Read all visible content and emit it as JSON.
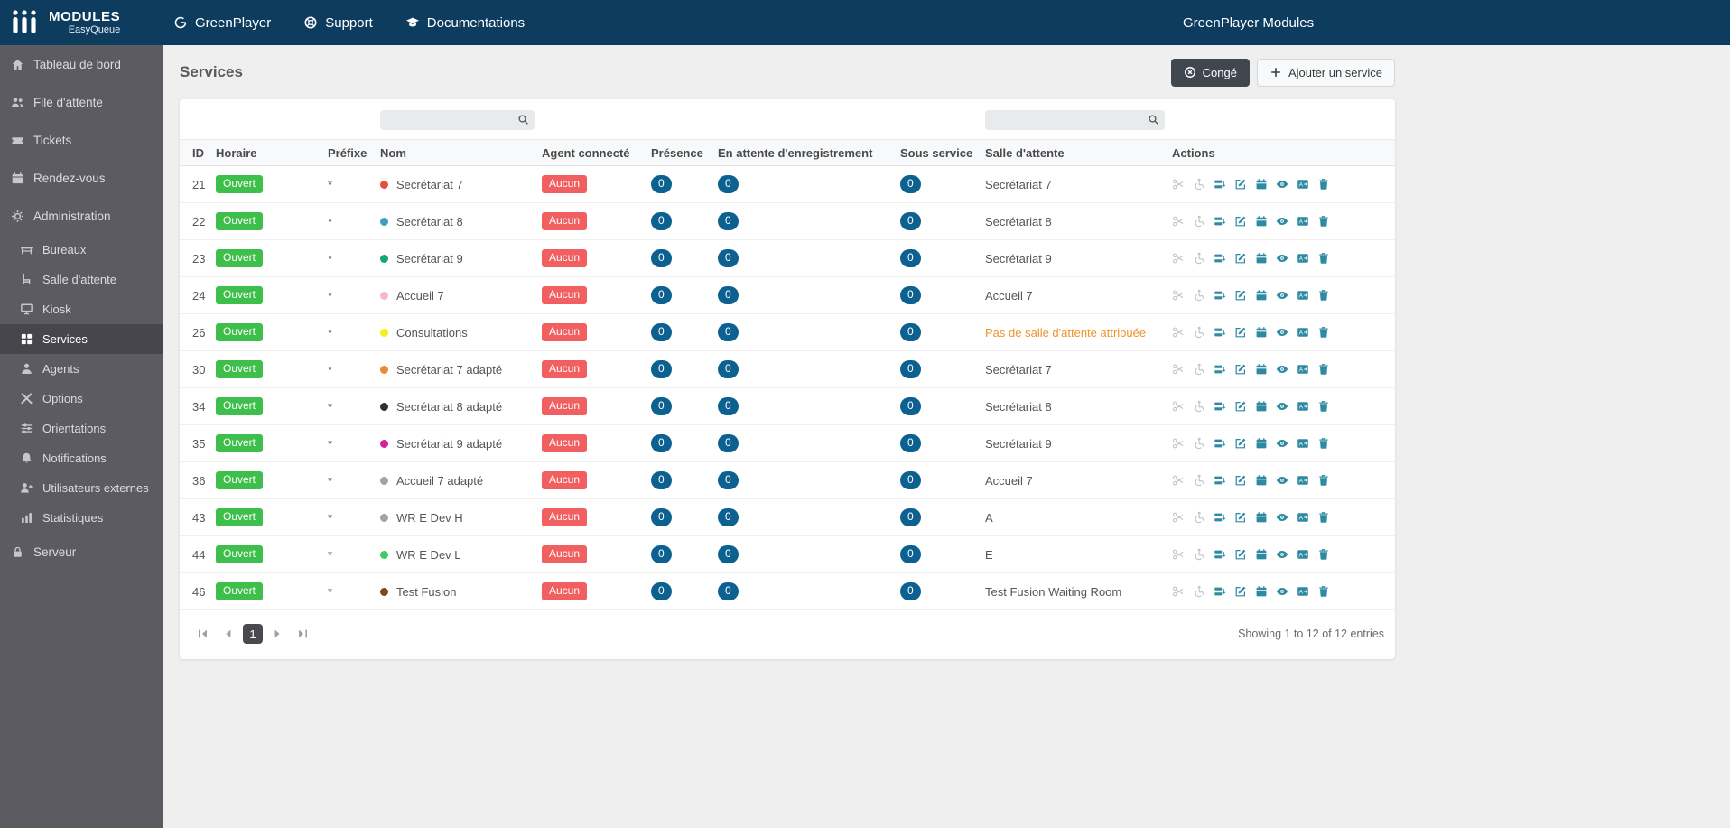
{
  "topbar": {
    "brand": {
      "title": "MODULES",
      "subtitle": "EasyQueue",
      "logo_icon": "bars-logo-icon"
    },
    "nav": [
      {
        "label": "GreenPlayer",
        "icon": "greenplayer-icon"
      },
      {
        "label": "Support",
        "icon": "support-icon"
      },
      {
        "label": "Documentations",
        "icon": "documentations-icon"
      }
    ],
    "right_title": "GreenPlayer Modules"
  },
  "sidebar": {
    "items": [
      {
        "label": "Tableau de bord",
        "icon": "dashboard-icon",
        "sub": false
      },
      {
        "label": "File d'attente",
        "icon": "queue-icon",
        "sub": false
      },
      {
        "label": "Tickets",
        "icon": "tickets-icon",
        "sub": false
      },
      {
        "label": "Rendez-vous",
        "icon": "appointments-icon",
        "sub": false
      },
      {
        "label": "Administration",
        "icon": "gear-icon",
        "sub": false
      },
      {
        "label": "Bureaux",
        "icon": "desk-icon",
        "sub": true
      },
      {
        "label": "Salle d'attente",
        "icon": "waiting-room-icon",
        "sub": true
      },
      {
        "label": "Kiosk",
        "icon": "kiosk-icon",
        "sub": true
      },
      {
        "label": "Services",
        "icon": "services-icon",
        "sub": true,
        "active": true
      },
      {
        "label": "Agents",
        "icon": "agent-icon",
        "sub": true
      },
      {
        "label": "Options",
        "icon": "options-icon",
        "sub": true
      },
      {
        "label": "Orientations",
        "icon": "orientations-icon",
        "sub": true
      },
      {
        "label": "Notifications",
        "icon": "notifications-icon",
        "sub": true
      },
      {
        "label": "Utilisateurs externes",
        "icon": "external-users-icon",
        "sub": true
      },
      {
        "label": "Statistiques",
        "icon": "statistics-icon",
        "sub": true
      },
      {
        "label": "Serveur",
        "icon": "server-icon",
        "sub": false
      }
    ]
  },
  "page": {
    "title": "Services",
    "leave_button": {
      "label": "Congé",
      "icon": "leave-icon"
    },
    "add_button": {
      "label": "Ajouter un service",
      "icon": "plus-icon"
    }
  },
  "table": {
    "search_name_value": "",
    "search_name_placeholder": "",
    "search_room_value": "",
    "search_room_placeholder": "",
    "columns": [
      "ID",
      "Horaire",
      "Préfixe",
      "Nom",
      "Agent connecté",
      "Présence",
      "En attente d'enregistrement",
      "Sous service",
      "Salle d'attente",
      "Actions"
    ],
    "rows": [
      {
        "id": "21",
        "schedule": "Ouvert",
        "prefix": "*",
        "name": "Secrétariat 7",
        "color": "#e74c3c",
        "agent": "Aucun",
        "presence": "0",
        "registering": "0",
        "sub_service": "0",
        "waiting_room": "Secrétariat 7"
      },
      {
        "id": "22",
        "schedule": "Ouvert",
        "prefix": "*",
        "name": "Secrétariat 8",
        "color": "#3e9fc0",
        "agent": "Aucun",
        "presence": "0",
        "registering": "0",
        "sub_service": "0",
        "waiting_room": "Secrétariat 8"
      },
      {
        "id": "23",
        "schedule": "Ouvert",
        "prefix": "*",
        "name": "Secrétariat 9",
        "color": "#18a476",
        "agent": "Aucun",
        "presence": "0",
        "registering": "0",
        "sub_service": "0",
        "waiting_room": "Secrétariat 9"
      },
      {
        "id": "24",
        "schedule": "Ouvert",
        "prefix": "*",
        "name": "Accueil 7",
        "color": "#f6b9c3",
        "agent": "Aucun",
        "presence": "0",
        "registering": "0",
        "sub_service": "0",
        "waiting_room": "Accueil 7"
      },
      {
        "id": "26",
        "schedule": "Ouvert",
        "prefix": "*",
        "name": "Consultations",
        "color": "#f6ef1c",
        "agent": "Aucun",
        "presence": "0",
        "registering": "0",
        "sub_service": "0",
        "waiting_room": "Pas de salle d'attente attribuée",
        "no_room": true
      },
      {
        "id": "30",
        "schedule": "Ouvert",
        "prefix": "*",
        "name": "Secrétariat 7 adapté",
        "color": "#ec8b33",
        "agent": "Aucun",
        "presence": "0",
        "registering": "0",
        "sub_service": "0",
        "waiting_room": "Secrétariat 7"
      },
      {
        "id": "34",
        "schedule": "Ouvert",
        "prefix": "*",
        "name": "Secrétariat 8 adapté",
        "color": "#2f2f2f",
        "agent": "Aucun",
        "presence": "0",
        "registering": "0",
        "sub_service": "0",
        "waiting_room": "Secrétariat 8"
      },
      {
        "id": "35",
        "schedule": "Ouvert",
        "prefix": "*",
        "name": "Secrétariat 9 adapté",
        "color": "#d6219c",
        "agent": "Aucun",
        "presence": "0",
        "registering": "0",
        "sub_service": "0",
        "waiting_room": "Secrétariat 9"
      },
      {
        "id": "36",
        "schedule": "Ouvert",
        "prefix": "*",
        "name": "Accueil 7 adapté",
        "color": "#a0a4a8",
        "agent": "Aucun",
        "presence": "0",
        "registering": "0",
        "sub_service": "0",
        "waiting_room": "Accueil 7"
      },
      {
        "id": "43",
        "schedule": "Ouvert",
        "prefix": "*",
        "name": "WR E Dev H",
        "color": "#a0a4a8",
        "agent": "Aucun",
        "presence": "0",
        "registering": "0",
        "sub_service": "0",
        "waiting_room": "A"
      },
      {
        "id": "44",
        "schedule": "Ouvert",
        "prefix": "*",
        "name": "WR E Dev L",
        "color": "#3ecb61",
        "agent": "Aucun",
        "presence": "0",
        "registering": "0",
        "sub_service": "0",
        "waiting_room": "E"
      },
      {
        "id": "46",
        "schedule": "Ouvert",
        "prefix": "*",
        "name": "Test Fusion",
        "color": "#7c4a12",
        "agent": "Aucun",
        "presence": "0",
        "registering": "0",
        "sub_service": "0",
        "waiting_room": "Test Fusion Waiting Room"
      }
    ],
    "action_icons": [
      {
        "name": "scissors-icon",
        "disabled": true
      },
      {
        "name": "wheelchair-icon",
        "disabled": true
      },
      {
        "name": "manage-queue-icon",
        "disabled": false
      },
      {
        "name": "edit-icon",
        "disabled": false
      },
      {
        "name": "calendar-icon",
        "disabled": false
      },
      {
        "name": "eye-icon",
        "disabled": false
      },
      {
        "name": "translate-icon",
        "disabled": false
      },
      {
        "name": "trash-icon",
        "disabled": false
      }
    ],
    "colors": {
      "open_badge": "#3ebe4a",
      "none_badge": "#f25f61",
      "count_pill": "#0d6190",
      "action_icon": "#2e8aa3",
      "no_room_text": "#f0932b",
      "topbar": "#0d3c5f",
      "sidebar": "#5c5b61"
    }
  },
  "pagination": {
    "pages": [
      "1"
    ],
    "active": "1",
    "summary": "Showing 1 to 12 of 12 entries"
  }
}
